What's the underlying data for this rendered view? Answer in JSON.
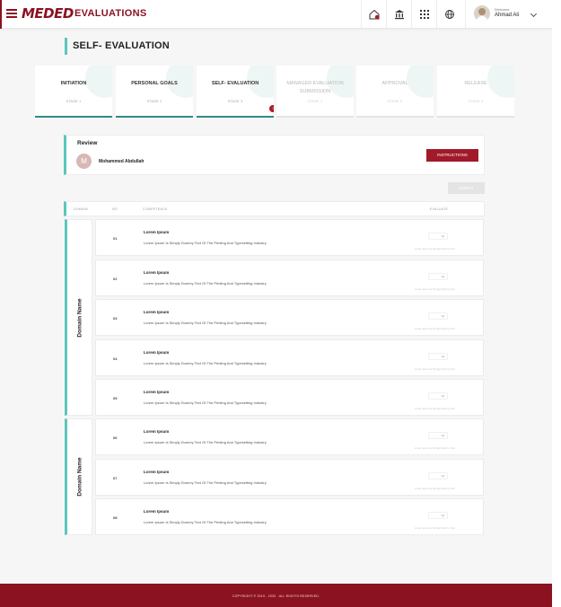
{
  "header": {
    "logo": "MEDED",
    "title": "EVALUATIONS",
    "icons": [
      "notification-home-icon",
      "bank-icon",
      "apps-grid-icon",
      "globe-icon"
    ],
    "user": {
      "welcome": "Welcome",
      "name": "Ahmad Ali"
    }
  },
  "page": {
    "title": "SELF- EVALUATION"
  },
  "stages": [
    {
      "name": "INITIATION",
      "step": "STAGE 1",
      "state": "done"
    },
    {
      "name": "PERSONAL GOALS",
      "step": "STAGE 2",
      "state": "done"
    },
    {
      "name": "SELF- EVALUATION",
      "step": "STAGE 3",
      "state": "current",
      "badge": "!"
    },
    {
      "name": "MANAGER EVALUATION SUBMISSION",
      "step": "STAGE 4",
      "state": "pending"
    },
    {
      "name": "APPROVAL",
      "step": "STAGE 5",
      "state": "pending"
    },
    {
      "name": "RELEASE",
      "step": "STAGE 6",
      "state": "pending"
    }
  ],
  "review": {
    "title": "Review",
    "avatar_initial": "M",
    "name": "Mohammed Abdullah",
    "instructions_label": "INSTRUCTIONS"
  },
  "submit_label": "SUBMIT",
  "table": {
    "headers": {
      "domain": "DOMAIN",
      "no": "NO",
      "competence": "COMPETENCE",
      "evaluate": "EVALUATE"
    },
    "domains": [
      {
        "name": "Domain Name",
        "rows": [
          {
            "no": "01",
            "title": "Lorem Ipsum",
            "desc": "Lorem Ipsum Is Simply Dummy Text Of The Printing And Typesetting Industry",
            "hint": "Lorem Ipsum Is Simply Dummy Text"
          },
          {
            "no": "02",
            "title": "Lorem Ipsum",
            "desc": "Lorem Ipsum Is Simply Dummy Text Of The Printing And Typesetting Industry",
            "hint": "Lorem Ipsum Is Simply Dummy Text"
          },
          {
            "no": "03",
            "title": "Lorem Ipsum",
            "desc": "Lorem Ipsum Is Simply Dummy Text Of The Printing And Typesetting Industry",
            "hint": "Lorem Ipsum Is Simply Dummy Text"
          },
          {
            "no": "04",
            "title": "Lorem Ipsum",
            "desc": "Lorem Ipsum Is Simply Dummy Text Of The Printing And Typesetting Industry",
            "hint": "Lorem Ipsum Is Simply Dummy Text"
          },
          {
            "no": "05",
            "title": "Lorem Ipsum",
            "desc": "Lorem Ipsum Is Simply Dummy Text Of The Printing And Typesetting Industry",
            "hint": "Lorem Ipsum Is Simply Dummy Text"
          }
        ]
      },
      {
        "name": "Domain Name",
        "rows": [
          {
            "no": "06",
            "title": "Lorem Ipsum",
            "desc": "Lorem Ipsum Is Simply Dummy Text Of The Printing And Typesetting Industry",
            "hint": "Lorem Ipsum Is Simply Dummy Text"
          },
          {
            "no": "07",
            "title": "Lorem Ipsum",
            "desc": "Lorem Ipsum Is Simply Dummy Text Of The Printing And Typesetting Industry",
            "hint": "Lorem Ipsum Is Simply Dummy Text"
          },
          {
            "no": "08",
            "title": "Lorem Ipsum",
            "desc": "Lorem Ipsum Is Simply Dummy Text Of The Printing And Typesetting Industry",
            "hint": "Lorem Ipsum Is Simply Dummy Text"
          }
        ]
      }
    ]
  },
  "footer": {
    "copyright": "COPYRIGHT © 2019 - 2020 . ALL RIGHTS RESERVED."
  },
  "colors": {
    "brand": "#8b1221",
    "accent": "#5cc6bd",
    "stage_done": "#2e8b8b",
    "button": "#a11a2a"
  }
}
